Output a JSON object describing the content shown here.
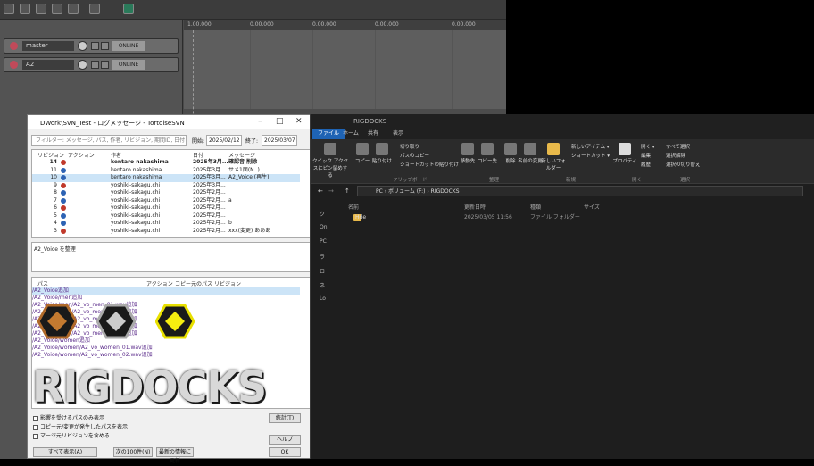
{
  "daw": {
    "tracks": [
      {
        "name": "master",
        "label": "ONLINE"
      },
      {
        "name": "A2",
        "label": "ONLINE"
      }
    ],
    "ruler": [
      "1.00.000",
      "0.00.000",
      "0.00.000",
      "0.00.000",
      "0.00.000"
    ]
  },
  "svn": {
    "title": "DWork\\SVN_Test - ログメッセージ - TortoiseSVN",
    "filter_placeholder": "フィルター: メッセージ, パス, 作者, リビジョン, 期間ID, 日付",
    "from_label": "開始:",
    "from_date": "2025/02/12",
    "to_label": "終了:",
    "to_date": "2025/03/07",
    "headers": [
      "リビジョン",
      "アクション",
      "作者",
      "日付",
      "メッセージ"
    ],
    "rows": [
      {
        "rev": "14",
        "author": "kentaro nakashima",
        "date": "2025年3月...",
        "msg": "確認音 削除",
        "bold": true
      },
      {
        "rev": "11",
        "author": "kentaro nakashima",
        "date": "2025年3月...",
        "msg": "サメ1面(N..)",
        "bold": false
      },
      {
        "rev": "10",
        "author": "kentaro nakashima",
        "date": "2025年3月...",
        "msg": "A2_Voice (再生)",
        "bold": false,
        "selected": true
      },
      {
        "rev": "9",
        "author": "yoshiki-sakagu.chi",
        "date": "2025年3月...",
        "msg": "",
        "bold": false
      },
      {
        "rev": "8",
        "author": "yoshiki-sakagu.chi",
        "date": "2025年2月...",
        "msg": "",
        "bold": false
      },
      {
        "rev": "7",
        "author": "yoshiki-sakagu.chi",
        "date": "2025年2月...",
        "msg": "a",
        "bold": false
      },
      {
        "rev": "6",
        "author": "yoshiki-sakagu.chi",
        "date": "2025年2月...",
        "msg": "",
        "bold": false
      },
      {
        "rev": "5",
        "author": "yoshiki-sakagu.chi",
        "date": "2025年2月...",
        "msg": "",
        "bold": false
      },
      {
        "rev": "4",
        "author": "yoshiki-sakagu.chi",
        "date": "2025年2月...",
        "msg": "b",
        "bold": false
      },
      {
        "rev": "3",
        "author": "yoshiki-sakagu.chi",
        "date": "2025年2月...",
        "msg": "xxx(変更) あああ",
        "bold": false
      }
    ],
    "message": "A2_Voice を整理",
    "path_headers": [
      "パス",
      "アクション",
      "コピー元のパス",
      "リビジョン"
    ],
    "paths": [
      {
        "path": "/A2_Voice",
        "action": "追加",
        "selected": true
      },
      {
        "path": "/A2_Voice/men",
        "action": "追加"
      },
      {
        "path": "/A2_Voice/men/A2_vo_men_01.wav",
        "action": "追加"
      },
      {
        "path": "/A2_Voice/men/A2_vo_men_02.wav",
        "action": "追加"
      },
      {
        "path": "/A2_Voice/men/A2_vo_men_03.wav",
        "action": "追加"
      },
      {
        "path": "/A2_Voice/men/A2_vo_men_04.wav",
        "action": "追加"
      },
      {
        "path": "/A2_Voice/men/A2_vo_men_05.wav",
        "action": "追加"
      },
      {
        "path": "/A2_Voice/women",
        "action": "追加"
      },
      {
        "path": "/A2_Voice/women/A2_vo_women_01.wav",
        "action": "追加"
      },
      {
        "path": "/A2_Voice/women/A2_vo_women_02.wav",
        "action": "追加"
      }
    ],
    "options": [
      "影響を受けるパスのみ表示",
      "コピー元/変更が発生したパスを表示",
      "マージ元リビジョンを含める"
    ],
    "buttons": {
      "stats": "統計(T)",
      "help": "ヘルプ",
      "show_all": "すべて表示(A)",
      "next100": "次の100件(N)",
      "refresh": "最新の情報に更新",
      "ok": "OK"
    }
  },
  "logo": {
    "text": "RIGDOCKS"
  },
  "explorer": {
    "title": "RIGDOCKS",
    "tabs": [
      "ファイル",
      "ホーム",
      "共有",
      "表示"
    ],
    "ribbon_buttons": [
      "クイック アクセスにピン留めする",
      "コピー",
      "貼り付け",
      "移動先",
      "コピー先",
      "削除",
      "名前の変更",
      "新しいフォルダー",
      "プロパティ"
    ],
    "ribbon_small": [
      "切り取り",
      "パスのコピー",
      "ショートカットの貼り付け",
      "新しいアイテム ▾",
      "ショートカット ▾",
      "開く ▾",
      "編集",
      "履歴",
      "すべて選択",
      "選択解除",
      "選択の切り替え"
    ],
    "sections": [
      "クリップボード",
      "整理",
      "新規",
      "開く",
      "選択"
    ],
    "breadcrumb": "PC › ボリューム (F:) › RIGDOCKS",
    "columns": [
      "名前",
      "更新日時",
      "種類",
      "サイズ"
    ],
    "files": [
      {
        "name": "Hde",
        "date": "2025/03/05 11:56",
        "type": "ファイル フォルダー",
        "size": ""
      }
    ],
    "nav_items": [
      "ク",
      "On",
      "PC",
      "ラ",
      "ロ",
      "ネ",
      "Lo"
    ]
  }
}
